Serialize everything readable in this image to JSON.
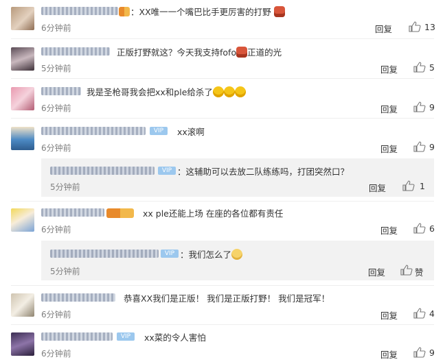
{
  "comments": [
    {
      "text": "：XX唯一一个嘴巴比手更厉害的打野",
      "time": "6分钟前",
      "reply": "回复",
      "likes": "13"
    },
    {
      "text": "正版打野就这？今天我支持fofo",
      "text2": "正道的光",
      "time": "5分钟前",
      "reply": "回复",
      "likes": "5"
    },
    {
      "text": "我是圣枪哥我会把xx和ple给杀了",
      "time": "6分钟前",
      "reply": "回复",
      "likes": "9"
    },
    {
      "text": "xx滚啊",
      "time": "6分钟前",
      "reply": "回复",
      "likes": "9"
    },
    {
      "text": "xx ple还能上场 在座的各位都有责任",
      "time": "6分钟前",
      "reply": "回复",
      "likes": "6"
    },
    {
      "text": "恭喜XX我们是正版！ 我们是正版打野！ 我们是冠军！",
      "time": "6分钟前",
      "reply": "回复",
      "likes": "4"
    },
    {
      "text": "xx菜的令人害怕",
      "time": "6分钟前",
      "reply": "回复",
      "likes": "9"
    }
  ],
  "replies": [
    {
      "text": "：这辅助可以去放二队练练吗，打团突然口？",
      "time": "5分钟前",
      "reply": "回复",
      "likes": "1"
    },
    {
      "text": "：我们怎么了",
      "time": "5分钟前",
      "reply": "回复",
      "likes": "赞"
    }
  ],
  "badges": {
    "vip": "VIP"
  },
  "icons": {
    "like": "thumbs-up-icon",
    "avatar": "user-avatar"
  },
  "colors": {
    "muted": "#808080",
    "reply_bg": "#f2f2f2",
    "vip": "#9cc8ee"
  }
}
